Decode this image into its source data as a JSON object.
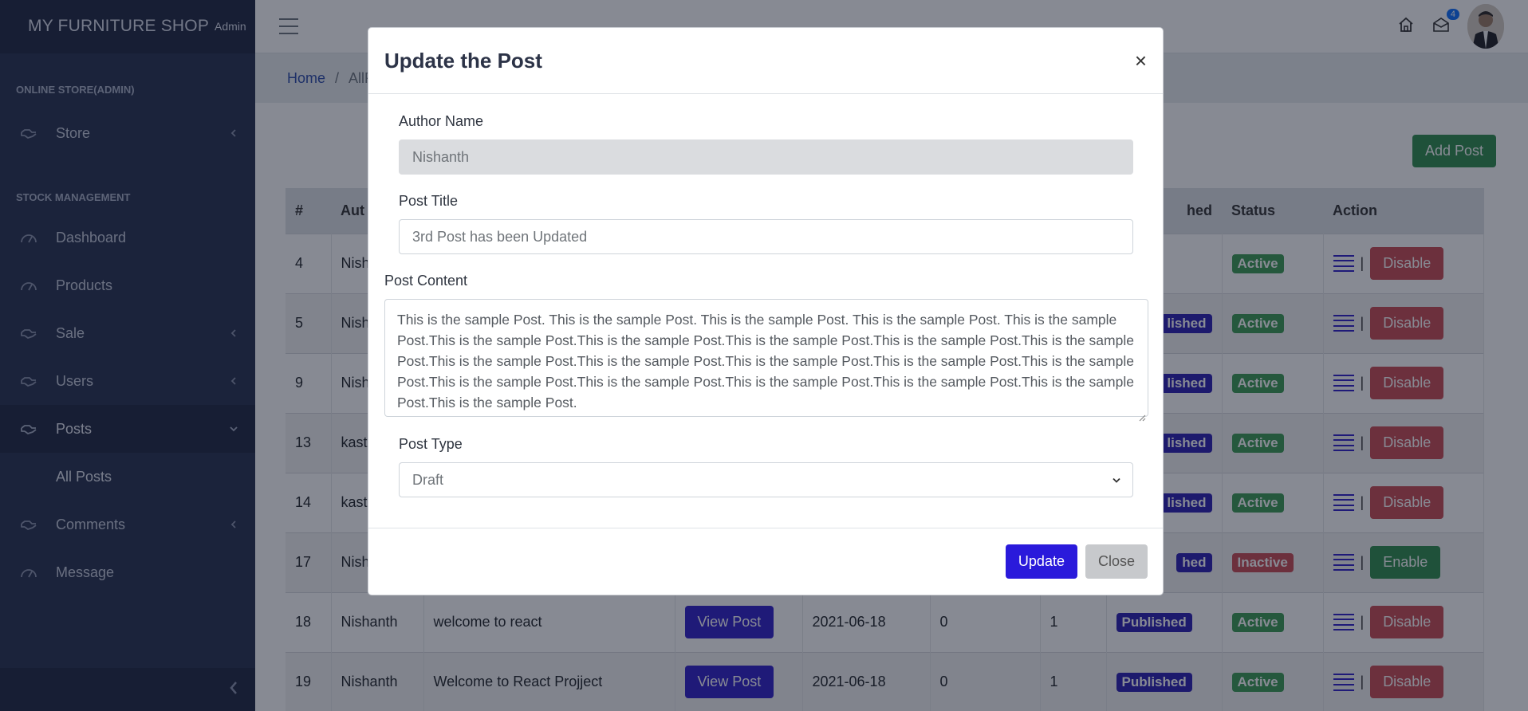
{
  "sidebar": {
    "brand_name": "MY FURNITURE SHOP",
    "brand_role": "Admin",
    "section_1": "ONLINE STORE(ADMIN)",
    "section_2": "STOCK MANAGEMENT",
    "items": [
      {
        "label": "Store",
        "icon": "hand-icon",
        "chevron": "left"
      },
      {
        "label": "Dashboard",
        "icon": "gauge-icon"
      },
      {
        "label": "Products",
        "icon": "gauge-icon"
      },
      {
        "label": "Sale",
        "icon": "hand-icon",
        "chevron": "left"
      },
      {
        "label": "Users",
        "icon": "hand-icon",
        "chevron": "left"
      },
      {
        "label": "Posts",
        "icon": "hand-icon",
        "chevron": "down"
      },
      {
        "label": "All Posts"
      },
      {
        "label": "Comments",
        "icon": "hand-icon",
        "chevron": "left"
      },
      {
        "label": "Message",
        "icon": "gauge-icon"
      }
    ]
  },
  "topbar": {
    "mail_count": "4"
  },
  "breadcrumb": {
    "home": "Home",
    "current": "AllP"
  },
  "page": {
    "add_post_label": "Add Post"
  },
  "table": {
    "headers": [
      "#",
      "Aut",
      "",
      "",
      "",
      "",
      "",
      "hed",
      "Status",
      "Action"
    ],
    "rows": [
      {
        "id": "4",
        "author": "Nish",
        "title": "",
        "view": "",
        "date": "",
        "c": "",
        "p": "",
        "state": "",
        "status": "Active",
        "action": "Disable"
      },
      {
        "id": "5",
        "author": "Nish",
        "title": "",
        "view": "",
        "date": "",
        "c": "",
        "p": "",
        "state": "lished",
        "status": "Active",
        "action": "Disable"
      },
      {
        "id": "9",
        "author": "Nish",
        "title": "",
        "view": "",
        "date": "",
        "c": "",
        "p": "",
        "state": "lished",
        "status": "Active",
        "action": "Disable"
      },
      {
        "id": "13",
        "author": "kast",
        "title": "",
        "view": "",
        "date": "",
        "c": "",
        "p": "",
        "state": "lished",
        "status": "Active",
        "action": "Disable"
      },
      {
        "id": "14",
        "author": "kast",
        "title": "",
        "view": "",
        "date": "",
        "c": "",
        "p": "",
        "state": "lished",
        "status": "Active",
        "action": "Disable"
      },
      {
        "id": "17",
        "author": "Nish",
        "title": "",
        "view": "",
        "date": "",
        "c": "",
        "p": "",
        "state": "hed",
        "status": "Inactive",
        "action": "Enable"
      },
      {
        "id": "18",
        "author": "Nishanth",
        "title": "welcome to react",
        "view": "View Post",
        "date": "2021-06-18",
        "c": "0",
        "p": "1",
        "state": "Published",
        "status": "Active",
        "action": "Disable"
      },
      {
        "id": "19",
        "author": "Nishanth",
        "title": "Welcome to React Projject",
        "view": "View Post",
        "date": "2021-06-18",
        "c": "0",
        "p": "1",
        "state": "Published",
        "status": "Active",
        "action": "Disable"
      }
    ]
  },
  "modal": {
    "title": "Update the Post",
    "close_glyph": "×",
    "author_label": "Author Name",
    "author_value": "Nishanth",
    "title_label": "Post Title",
    "title_value": "3rd Post has been Updated",
    "content_label": "Post Content",
    "content_value": "This is the sample Post. This is the sample Post. This is the sample Post. This is the sample Post. This is the sample Post.This is the sample Post.This is the sample Post.This is the sample Post.This is the sample Post.This is the sample Post.This is the sample Post.This is the sample Post.This is the sample Post.This is the sample Post.This is the sample Post.This is the sample Post.This is the sample Post.This is the sample Post.This is the sample Post.This is the sample Post.This is the sample Post.",
    "type_label": "Post Type",
    "type_value": "Draft",
    "update_label": "Update",
    "close_label": "Close"
  }
}
